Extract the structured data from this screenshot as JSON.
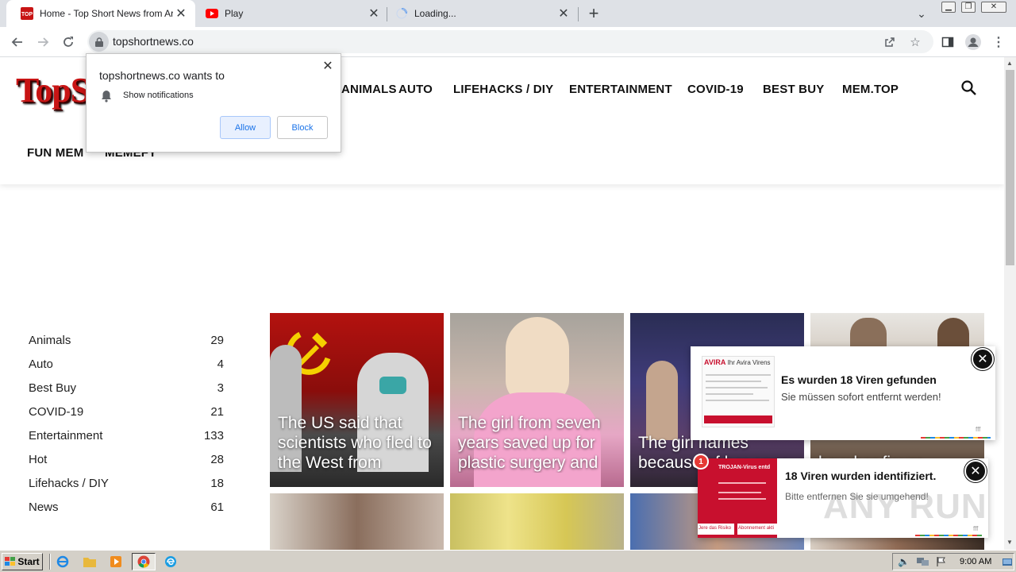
{
  "browser": {
    "tabs": [
      {
        "title": "Home - Top Short News from Around the World",
        "favicon": "topsnews-favicon",
        "active": true
      },
      {
        "title": "Play",
        "favicon": "youtube-favicon",
        "active": false
      },
      {
        "title": "Loading...",
        "favicon": "loading-spinner",
        "active": false
      }
    ],
    "new_tab_glyph": "+",
    "tab_list_glyph": "⌄",
    "url": "topshortnews.co"
  },
  "site": {
    "logo_text": "TopS",
    "nav": [
      "ANIMALS",
      "AUTO",
      "LIFEHACKS / DIY",
      "ENTERTAINMENT",
      "COVID-19",
      "BEST BUY",
      "MEM.TOP",
      "FUN MEM",
      "MEMEFY"
    ],
    "categories": [
      {
        "name": "Animals",
        "count": "29"
      },
      {
        "name": "Auto",
        "count": "4"
      },
      {
        "name": "Best Buy",
        "count": "3"
      },
      {
        "name": "COVID-19",
        "count": "21"
      },
      {
        "name": "Entertainment",
        "count": "133"
      },
      {
        "name": "Hot",
        "count": "28"
      },
      {
        "name": "Lifehacks / DIY",
        "count": "18"
      },
      {
        "name": "News",
        "count": "61"
      }
    ],
    "cards": [
      {
        "title": "The US said that scientists who fled to the West from"
      },
      {
        "title": "The girl from seven years saved up for plastic surgery and"
      },
      {
        "title": "The girl names because of her appe"
      },
      {
        "title": "how her figure"
      }
    ]
  },
  "permission": {
    "title": "topshortnews.co wants to",
    "text": "Show notifications",
    "allow": "Allow",
    "block": "Block"
  },
  "scam1": {
    "brand": "AVIRA",
    "brand_sub": "Ihr Avira Virens",
    "title": "Es wurden 18 Viren gefunden",
    "subtitle": "Sie müssen sofort entfernt werden!",
    "tag": "fff"
  },
  "scam2": {
    "badge": "1",
    "brand": "TROJAN-Virus entd",
    "title": "18 Viren wurden identifiziert.",
    "subtitle": "Bitte entfernen Sie sie umgehend!",
    "tag": "fff",
    "button1": "Jere das Risiko",
    "button2": "Abonnement akti"
  },
  "watermark": "ANY RUN",
  "taskbar": {
    "start": "Start",
    "clock": "9:00 AM"
  },
  "colors": {
    "accent": "#1a73e8",
    "logo_red": "#c81414",
    "tab_strip": "#dee1e6"
  }
}
